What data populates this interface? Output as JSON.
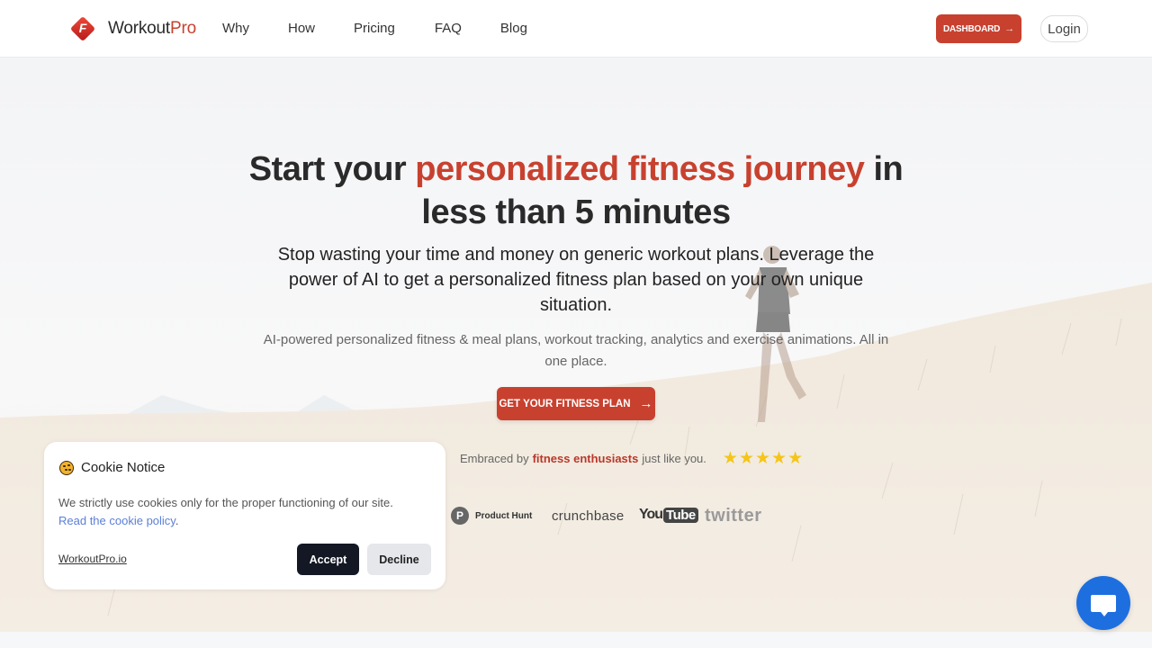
{
  "header": {
    "logo": {
      "brand": "Workout",
      "brand_accent": "Pro",
      "icon": "workoutpro-logo-icon"
    },
    "nav": [
      "Why",
      "How",
      "Pricing",
      "FAQ",
      "Blog"
    ],
    "dashboard_label": "DASHBOARD",
    "dashboard_icon": "→",
    "login_label": "Login"
  },
  "hero": {
    "headline_start": "Start your ",
    "headline_accent": "personalized fitness journey",
    "headline_end": " in less than 5 minutes",
    "subheadline": "Stop wasting your time and money on generic workout plans. Leverage the power of AI to get a personalized fitness plan based on your own unique situation.",
    "description": "AI-powered personalized fitness & meal plans, workout tracking, analytics and exercise animations. All in one place.",
    "cta_label": "GET YOUR FITNESS PLAN",
    "cta_icon": "→",
    "social_proof": {
      "prefix": "Embraced by",
      "highlight": "fitness enthusiasts",
      "suffix": "just like you.",
      "rating": 5,
      "rating_max": 5
    },
    "logos": {
      "product_hunt": {
        "letter": "P",
        "name": "Product Hunt"
      },
      "crunchbase": "crunchbase",
      "youtube": {
        "you": "You",
        "tube": "Tube"
      },
      "twitter": "twitter"
    }
  },
  "cookie": {
    "title": "Cookie Notice",
    "text": "We strictly use cookies only for the proper functioning of our site.",
    "link": "Read the cookie policy",
    "link_suffix": ".",
    "site": "WorkoutPro.io",
    "accept_label": "Accept",
    "decline_label": "Decline"
  },
  "colors": {
    "accent": "#c8412f",
    "chat": "#1d6fe0",
    "star": "#f5c518",
    "accept_bg": "#141824",
    "link": "#5b7fd6"
  },
  "chat_widget": {
    "icon": "chat-bubble-icon"
  }
}
